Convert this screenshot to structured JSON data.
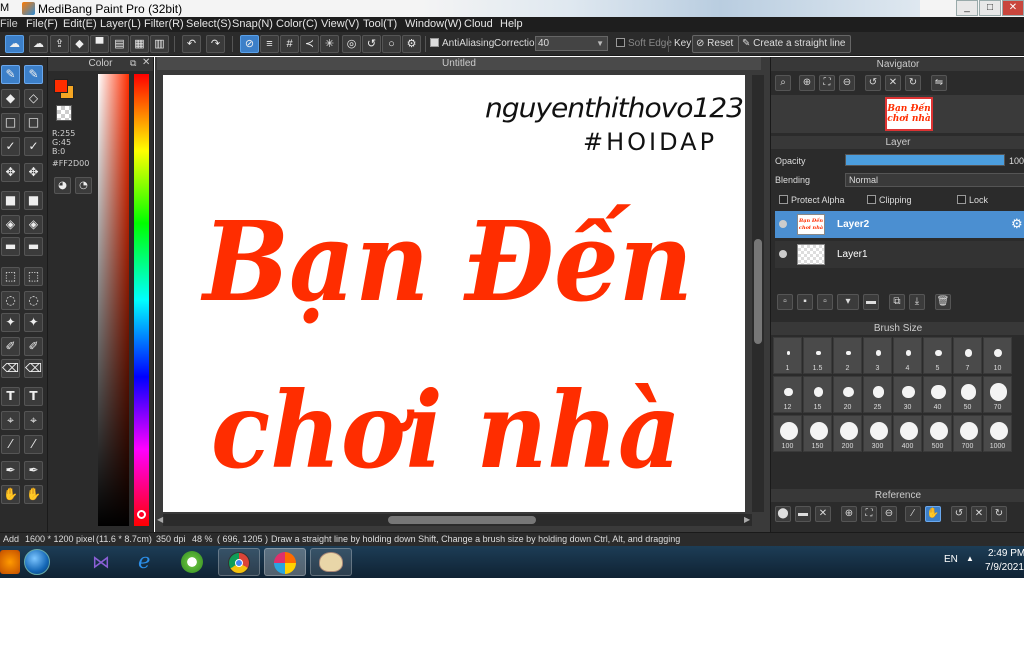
{
  "titlebar": {
    "title": "MediBang Paint Pro (32bit)",
    "left_cut": "M",
    "buttons": [
      "_",
      "□",
      "✕"
    ]
  },
  "menu": [
    "File(F)",
    "Edit(E)",
    "Layer(L)",
    "Filter(R)",
    "Select(S)",
    "Snap(N)",
    "Color(C)",
    "View(V)",
    "Tool(T)",
    "Window(W)",
    "Cloud",
    "Help"
  ],
  "menu_left_cut": "File",
  "toolbar": {
    "antialiasing_label": "AntiAliasing",
    "correction_label": "Correction",
    "correction_value": "40",
    "soft_edge_label": "Soft Edge",
    "key_label": "Key",
    "reset_label": "Reset",
    "straight_line_label": "Create a straight line"
  },
  "color_panel": {
    "title": "Color",
    "r": "R:255",
    "g": "G:45",
    "b": "B:0",
    "hex": "#FF2D00",
    "colors": {
      "foreground": "#ff2d00",
      "background": "#f5a623"
    }
  },
  "document": {
    "tab_title": "Untitled",
    "artwork": {
      "signature": "nguyenthithovo123",
      "hashtag": "#HOIDAP",
      "line1": "Bạn Đến",
      "line2": "chơi nhà",
      "ink_color": "#ff2d00"
    }
  },
  "navigator": {
    "title": "Navigator",
    "thumb_line1": "Bạn Đến",
    "thumb_line2": "chơi nhà"
  },
  "layer_panel": {
    "title": "Layer",
    "opacity_label": "Opacity",
    "opacity_value": "100",
    "opacity_level": 1.0,
    "blending_label": "Blending",
    "blending_value": "Normal",
    "protect_alpha_label": "Protect Alpha",
    "clipping_label": "Clipping",
    "lock_label": "Lock",
    "layers": [
      {
        "name": "Layer2",
        "selected": true
      },
      {
        "name": "Layer1",
        "selected": false
      }
    ]
  },
  "brush_size": {
    "title": "Brush Size",
    "sizes": [
      "1",
      "1.5",
      "2",
      "3",
      "4",
      "5",
      "7",
      "10",
      "12",
      "15",
      "20",
      "25",
      "30",
      "40",
      "50",
      "70",
      "100",
      "150",
      "200",
      "300",
      "400",
      "500",
      "700",
      "1000"
    ]
  },
  "reference": {
    "title": "Reference"
  },
  "statusbar": {
    "left_cut": "Add",
    "pixels": "1600 * 1200 pixel",
    "physical": "(11.6 * 8.7cm)",
    "dpi": "350 dpi",
    "zoom": "48 %",
    "coords": "( 696, 1205 )",
    "hint": "Draw a straight line by holding down Shift, Change a brush size by holding down Ctrl, Alt, and dragging"
  },
  "taskbar": {
    "lang": "EN",
    "time": "2:49 PM",
    "date": "7/9/2021",
    "apps": [
      "visual-studio",
      "internet-explorer",
      "coccoc",
      "chrome",
      "medibang",
      "paint"
    ]
  }
}
